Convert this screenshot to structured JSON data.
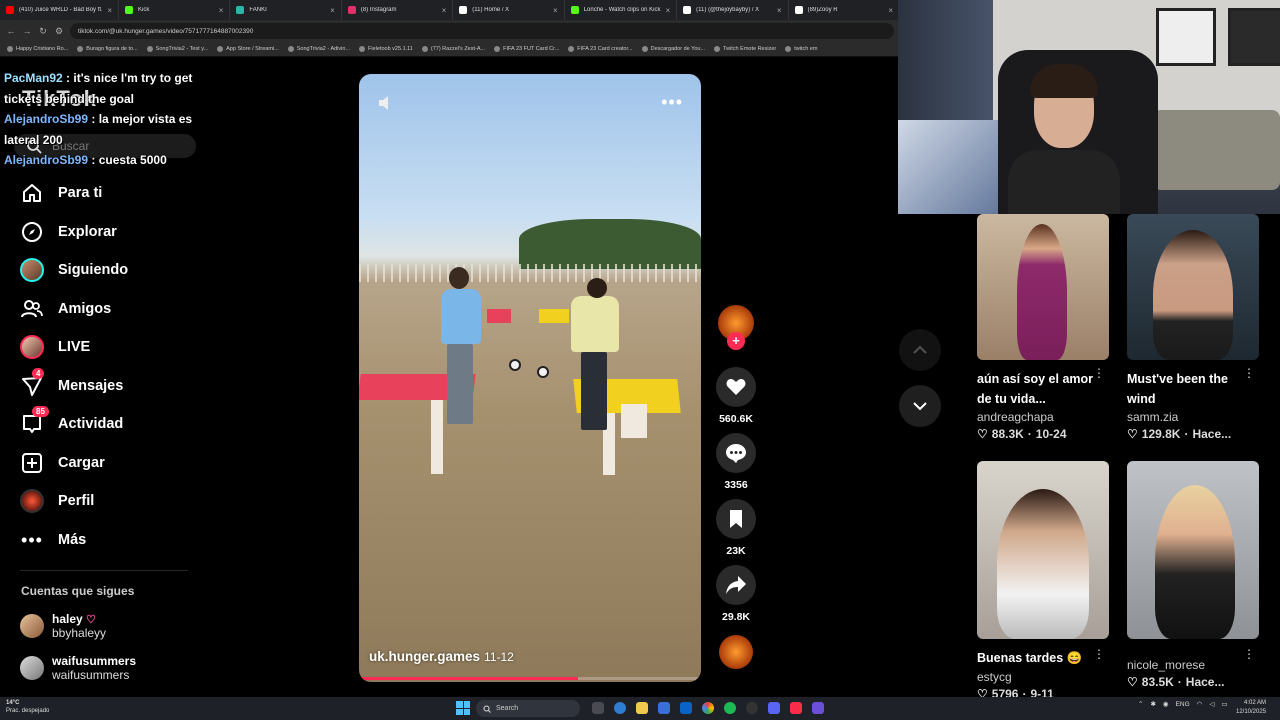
{
  "browser": {
    "tabs": [
      {
        "label": "(410) Juice WRLD - Bad Boy ft.",
        "color": "#ff0000"
      },
      {
        "label": "Kick",
        "color": "#53fc18"
      },
      {
        "label": "FANKI",
        "color": "#2ab7a9"
      },
      {
        "label": "(8) Instagram",
        "color": "#e1306c"
      },
      {
        "label": "(11) Home / X",
        "color": "#ffffff"
      },
      {
        "label": "Lonche - Watch clips on Kick",
        "color": "#53fc18"
      },
      {
        "label": "(11) (@thejoybayby) / X",
        "color": "#ffffff"
      },
      {
        "label": "(89)Zooy R",
        "color": "#ffffff"
      }
    ],
    "url": "tiktok.com/@uk.hunger.games/video/7571777164887002390",
    "bookmarks": [
      "Happy Cristiano Ro...",
      "Burago figura de to...",
      "SongTrivia2 - Test y...",
      "App Store / Streami...",
      "SongTrivia2 - Adivin...",
      "Fieletoob v25.1.11",
      "(77) Razzel's Zest-A...",
      "FIFA 23 FUT Card Cr...",
      "FIFA 23 Card creator...",
      "Descargador de You...",
      "Twitch Emote Resizer",
      "twitch em"
    ]
  },
  "chat": [
    {
      "user": "PacMan92",
      "text": " : it's nice I'm try to get tickets behind the goal"
    },
    {
      "user": "AlejandroSb99",
      "text": " : la mejor vista es lateral 200"
    },
    {
      "user": "AlejandroSb99",
      "text": " : cuesta 5000"
    }
  ],
  "sidebar": {
    "logo": "TikTok",
    "search_placeholder": "Buscar",
    "items": [
      {
        "label": "Para ti",
        "icon": "home-icon"
      },
      {
        "label": "Explorar",
        "icon": "compass-icon"
      },
      {
        "label": "Siguiendo",
        "icon": "following-avatar"
      },
      {
        "label": "Amigos",
        "icon": "friends-icon"
      },
      {
        "label": "LIVE",
        "icon": "live-avatar"
      },
      {
        "label": "Mensajes",
        "icon": "messages-icon",
        "badge": "4"
      },
      {
        "label": "Actividad",
        "icon": "activity-icon",
        "badge": "85"
      },
      {
        "label": "Cargar",
        "icon": "upload-icon"
      },
      {
        "label": "Perfil",
        "icon": "profile-avatar"
      },
      {
        "label": "Más",
        "icon": "more-icon"
      }
    ],
    "following_title": "Cuentas que sigues",
    "accounts": [
      {
        "name": "haley",
        "handle": "bbyhaleyy"
      },
      {
        "name": "waifusummers",
        "handle": "waifusummers"
      }
    ]
  },
  "video": {
    "author": "uk.hunger.games",
    "date": "11-12",
    "progress": 0.64
  },
  "actions": {
    "likes": "560.6K",
    "comments": "3356",
    "saves": "23K",
    "shares": "29.8K",
    "accent": "#fe2c55"
  },
  "grid": [
    {
      "title": "aún así soy el amor de tu vida...",
      "author": "andreagchapa",
      "likes": "88.3K",
      "date": "10-24"
    },
    {
      "title": "Must've been the wind",
      "author": "samm.zia",
      "likes": "129.8K",
      "date": "Hace..."
    },
    {
      "title": "Buenas tardes 😄",
      "author": "estycg",
      "likes": "5796",
      "date": "9-11"
    },
    {
      "title": "",
      "author": "nicole_morese",
      "likes": "83.5K",
      "date": "Hace..."
    }
  ],
  "taskbar": {
    "temp": "14°C",
    "weather": "Prac. despejado",
    "search": "Search",
    "lang": "ENG",
    "time": "4:02 AM",
    "date": "12/10/2025"
  }
}
